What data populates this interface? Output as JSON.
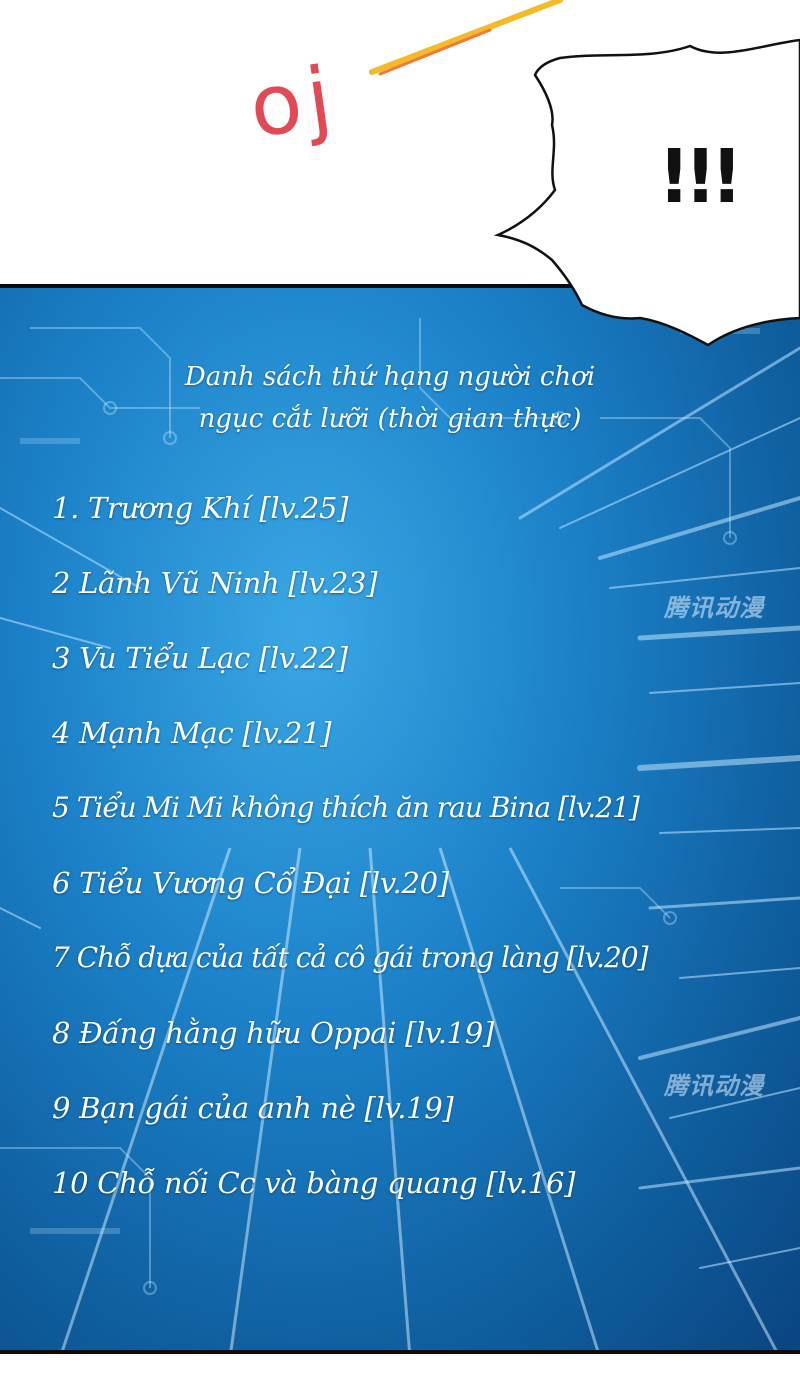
{
  "sound_effect": "oj",
  "speech_bubble": {
    "text": "!!!"
  },
  "ranking_panel": {
    "title_lines": [
      "Danh sách thứ hạng người chơi",
      "ngục cắt lưỡi (thời gian thực)"
    ],
    "entries": [
      "1. Trương Khí [lv.25]",
      "2 Lãnh Vũ Ninh [lv.23]",
      "3 Vu Tiểu Lạc [lv.22]",
      "4 Mạnh Mạc [lv.21]",
      "5 Tiểu Mi Mi không thích ăn rau Bina [lv.21]",
      "6 Tiểu Vương Cổ Đại [lv.20]",
      "7 Chỗ dựa của tất cả cô gái trong làng [lv.20]",
      "8 Đấng hằng hữu Oppai [lv.19]",
      "9 Bạn gái của anh nè [lv.19]",
      "10 Chỗ nối Cc và bàng quang [lv.16]"
    ]
  },
  "colors": {
    "panel_blue": "#1c82c9",
    "panel_deep": "#0a4580",
    "sfx_red": "#e14a54",
    "sfx_streak": "#f6b928"
  }
}
